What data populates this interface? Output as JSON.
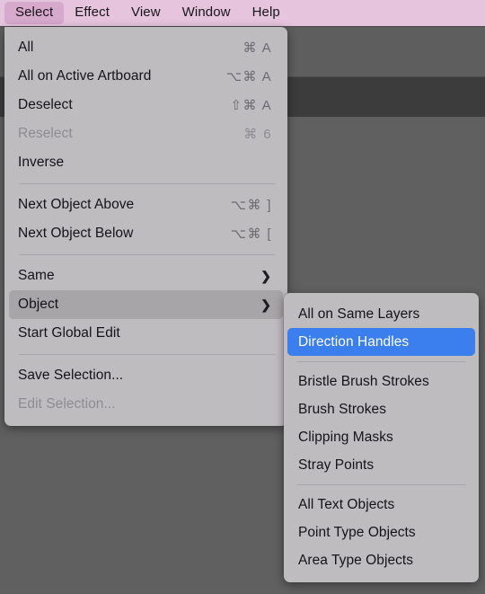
{
  "menubar": {
    "items": [
      {
        "label": "Select",
        "active": true
      },
      {
        "label": "Effect",
        "active": false
      },
      {
        "label": "View",
        "active": false
      },
      {
        "label": "Window",
        "active": false
      },
      {
        "label": "Help",
        "active": false
      }
    ]
  },
  "select_menu": {
    "groups": [
      {
        "items": [
          {
            "label": "All",
            "shortcut": "⌘ A",
            "disabled": false
          },
          {
            "label": "All on Active Artboard",
            "shortcut": "⌥⌘ A",
            "disabled": false
          },
          {
            "label": "Deselect",
            "shortcut": "⇧⌘ A",
            "disabled": false
          },
          {
            "label": "Reselect",
            "shortcut": "⌘ 6",
            "disabled": true
          },
          {
            "label": "Inverse",
            "shortcut": "",
            "disabled": false
          }
        ]
      },
      {
        "items": [
          {
            "label": "Next Object Above",
            "shortcut": "⌥⌘ ]",
            "disabled": false
          },
          {
            "label": "Next Object Below",
            "shortcut": "⌥⌘ [",
            "disabled": false
          }
        ]
      },
      {
        "items": [
          {
            "label": "Same",
            "shortcut": "",
            "disabled": false,
            "submenu": true
          },
          {
            "label": "Object",
            "shortcut": "",
            "disabled": false,
            "submenu": true,
            "highlighted": true
          },
          {
            "label": "Start Global Edit",
            "shortcut": "",
            "disabled": false
          }
        ]
      },
      {
        "items": [
          {
            "label": "Save Selection...",
            "shortcut": "",
            "disabled": false
          },
          {
            "label": "Edit Selection...",
            "shortcut": "",
            "disabled": true
          }
        ]
      }
    ]
  },
  "object_submenu": {
    "groups": [
      {
        "items": [
          {
            "label": "All on Same Layers",
            "selected": false
          },
          {
            "label": "Direction Handles",
            "selected": true
          }
        ]
      },
      {
        "items": [
          {
            "label": "Bristle Brush Strokes",
            "selected": false
          },
          {
            "label": "Brush Strokes",
            "selected": false
          },
          {
            "label": "Clipping Masks",
            "selected": false
          },
          {
            "label": "Stray Points",
            "selected": false
          }
        ]
      },
      {
        "items": [
          {
            "label": "All Text Objects",
            "selected": false
          },
          {
            "label": "Point Type Objects",
            "selected": false
          },
          {
            "label": "Area Type Objects",
            "selected": false
          }
        ]
      }
    ]
  },
  "icons": {
    "submenu_arrow": "❯"
  },
  "colors": {
    "menubar_background": "#e7c4de",
    "menubar_active_item": "#d6a9cd",
    "menu_panel_background": "#bfbcc0",
    "menu_highlight_gray": "#a8a5a9",
    "submenu_selection_blue": "#3b7eed",
    "app_background": "#5e5e5e",
    "app_toolbar_band": "#3c3c3c"
  }
}
